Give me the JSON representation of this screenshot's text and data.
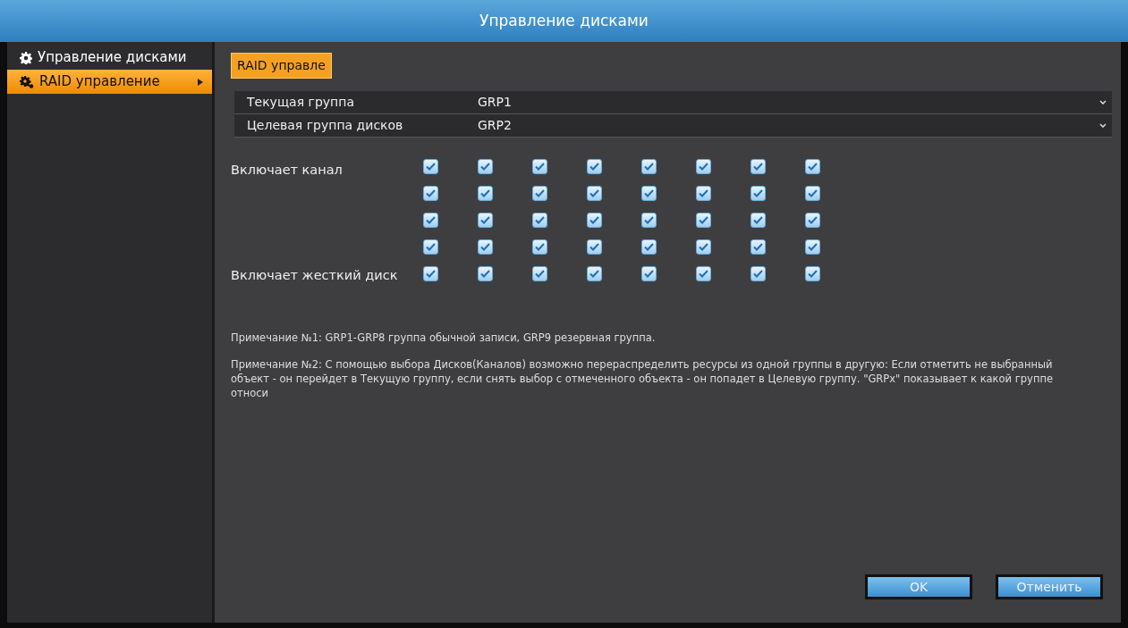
{
  "window": {
    "title": "Управление дисками"
  },
  "sidebar": {
    "items": [
      {
        "label": "Управление дисками",
        "selected": false,
        "kind": "gear"
      },
      {
        "label": "RAID управление",
        "selected": true,
        "kind": "gears"
      }
    ]
  },
  "tab": {
    "label": "RAID управле",
    "selected": true
  },
  "fields": [
    {
      "label": "Текущая группа",
      "value": "GRP1"
    },
    {
      "label": "Целевая группа дисков",
      "value": "GRP2"
    }
  ],
  "channels": {
    "label": "Включает канал",
    "rows": [
      [
        {
          "checked": true
        },
        {
          "checked": true
        },
        {
          "checked": true
        },
        {
          "checked": true
        },
        {
          "checked": true
        },
        {
          "checked": true
        },
        {
          "checked": true
        },
        {
          "checked": true
        }
      ],
      [
        {
          "checked": true
        },
        {
          "checked": true
        },
        {
          "checked": true
        },
        {
          "checked": true
        },
        {
          "checked": true
        },
        {
          "checked": true
        },
        {
          "checked": true
        },
        {
          "checked": true
        }
      ],
      [
        {
          "checked": true
        },
        {
          "checked": true
        },
        {
          "checked": true
        },
        {
          "checked": true
        },
        {
          "checked": true
        },
        {
          "checked": true
        },
        {
          "checked": true
        },
        {
          "checked": true
        }
      ],
      [
        {
          "checked": true
        },
        {
          "checked": true
        },
        {
          "checked": true
        },
        {
          "checked": true
        },
        {
          "checked": true
        },
        {
          "checked": true
        },
        {
          "checked": true
        },
        {
          "checked": true
        }
      ]
    ]
  },
  "disks": {
    "label": "Включает жесткий диск",
    "items": [
      {
        "checked": true
      },
      {
        "checked": true
      },
      {
        "checked": true
      },
      {
        "checked": true
      },
      {
        "checked": true
      },
      {
        "checked": true
      },
      {
        "checked": true
      },
      {
        "checked": true
      }
    ]
  },
  "notes": [
    "Примечание №1: GRP1-GRP8 группа обычной записи, GRP9 резервная группа.",
    "Примечание №2: С помощью выбора Дисков(Каналов) возможно перераспределить ресурсы из одной группы в другую: Если отметить не выбранный объект - он перейдет в Текущую группу, если снять выбор с отмеченного объекта - он попадет в Целевую группу. \"GRPx\" показывает к какой группе относи"
  ],
  "buttons": [
    "OK",
    "Отменить"
  ]
}
